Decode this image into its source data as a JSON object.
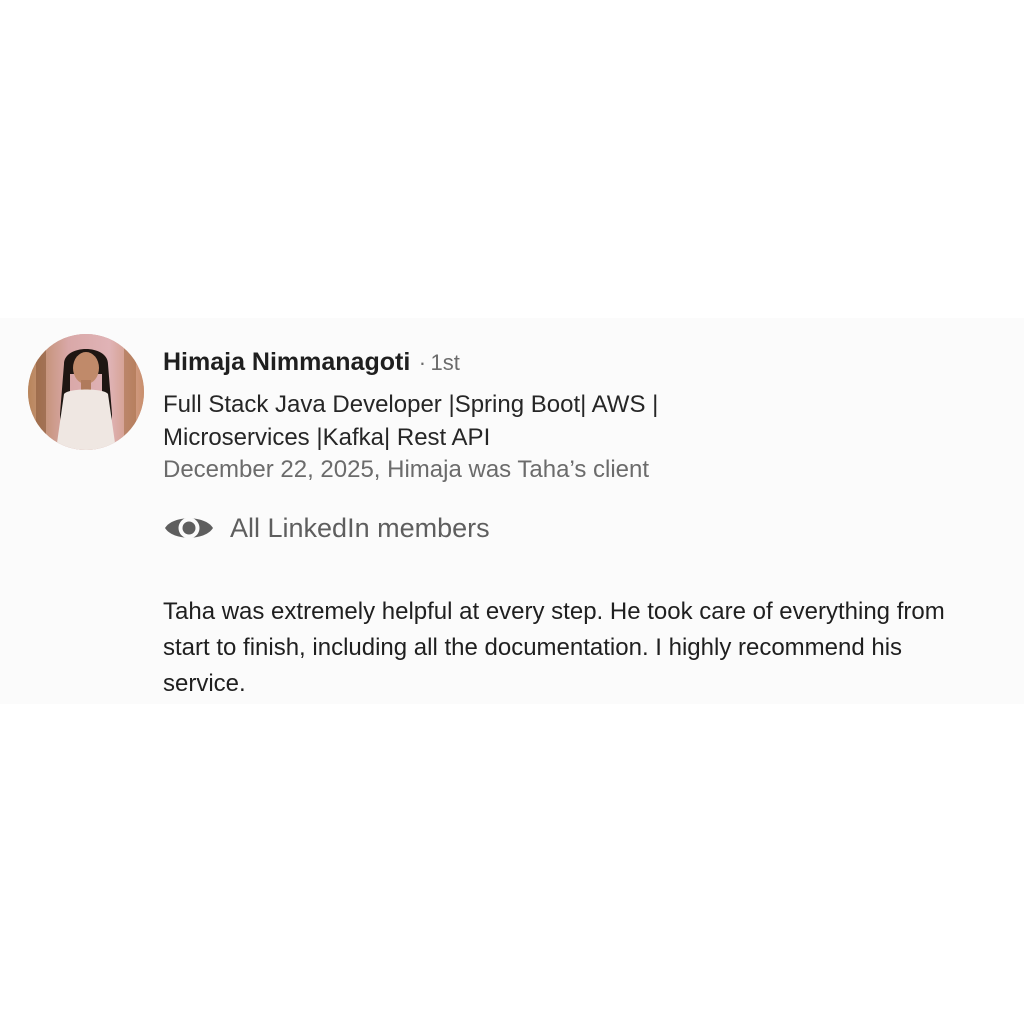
{
  "recommendation": {
    "author_name": "Himaja Nimmanagoti",
    "degree_separator": "·",
    "connection_degree": "1st",
    "headline": "Full Stack Java Developer |Spring Boot| AWS | Microservices |Kafka| Rest API",
    "date_relationship": "December 22, 2025, Himaja was Taha’s client",
    "visibility_icon": "eye-icon",
    "visibility_label": "All LinkedIn members",
    "text": "Taha was extremely helpful at every step. He took care of everything from start to finish, including all the documentation. I highly recommend his service."
  },
  "colors": {
    "name": "#1f1f1f",
    "secondary_text": "#6b6b6b",
    "body_text": "#1f1f1f",
    "icon": "#5e5e5e",
    "card_background": "#fbfbfb"
  }
}
